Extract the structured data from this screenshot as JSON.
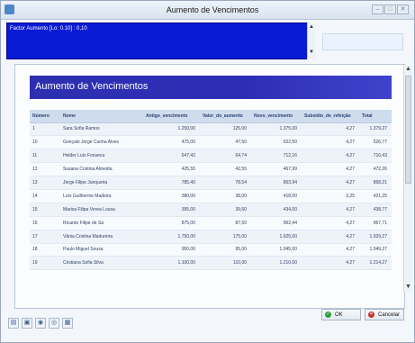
{
  "window": {
    "title": "Aumento de Vencimentos",
    "controls": [
      "–",
      "□",
      "✕"
    ]
  },
  "factor": {
    "label": "Factor Aumento [Lo: 0.10] : 0,10",
    "scroll_up": "▲",
    "scroll_down": "▼"
  },
  "top_button": {
    "label": ""
  },
  "report": {
    "title": "Aumento de Vencimentos",
    "columns": [
      "Número",
      "Nome",
      "Antigo_vencimento",
      "Valor_do_aumento",
      "Novo_vencimento",
      "Subsídio_de_refeição",
      "Total"
    ],
    "rows": [
      [
        "1",
        "Sara Sofia Ramos",
        "1.250,00",
        "125,00",
        "1.375,00",
        "4,27",
        "1.379,27"
      ],
      [
        "10",
        "Gonçalo Jorge Cunha Alves",
        "475,00",
        "47,50",
        "522,50",
        "4,27",
        "526,77"
      ],
      [
        "11",
        "Helder Luís Fonseca",
        "647,42",
        "64,74",
        "712,16",
        "4,27",
        "716,43"
      ],
      [
        "12",
        "Susana Cristina Almeida",
        "425,55",
        "42,55",
        "467,99",
        "4,27",
        "472,26"
      ],
      [
        "13",
        "Jorge Filipe Junqueira",
        "785,40",
        "78,54",
        "863,94",
        "4,27",
        "868,21"
      ],
      [
        "14",
        "Luís Guilherme Madeira",
        "380,00",
        "38,00",
        "418,00",
        "3,25",
        "421,25"
      ],
      [
        "15",
        "Marisa Filipa Verea Lousa",
        "395,00",
        "39,60",
        "434,00",
        "4,27",
        "438,77"
      ],
      [
        "16",
        "Ricardo Filipe de Sá",
        "875,00",
        "87,50",
        "962,44",
        "4,27",
        "967,71"
      ],
      [
        "17",
        "Vânia Cristina Madureira",
        "1.750,00",
        "175,00",
        "1.925,00",
        "4,27",
        "1.929,27"
      ],
      [
        "18",
        "Paulo Miguel Sousa",
        "950,00",
        "95,00",
        "1.045,00",
        "4,27",
        "1.049,27"
      ],
      [
        "19",
        "Cristiana Sofia Silva",
        "1.100,00",
        "110,00",
        "1.210,00",
        "4,27",
        "1.214,27"
      ]
    ]
  },
  "scrollbar": {
    "up": "▲",
    "down": "▼"
  },
  "buttons": {
    "ok": "OK",
    "cancel": "Cancelar"
  },
  "icons": [
    "print-icon",
    "folder-icon",
    "globe-icon",
    "settings-icon",
    "export-icon"
  ]
}
